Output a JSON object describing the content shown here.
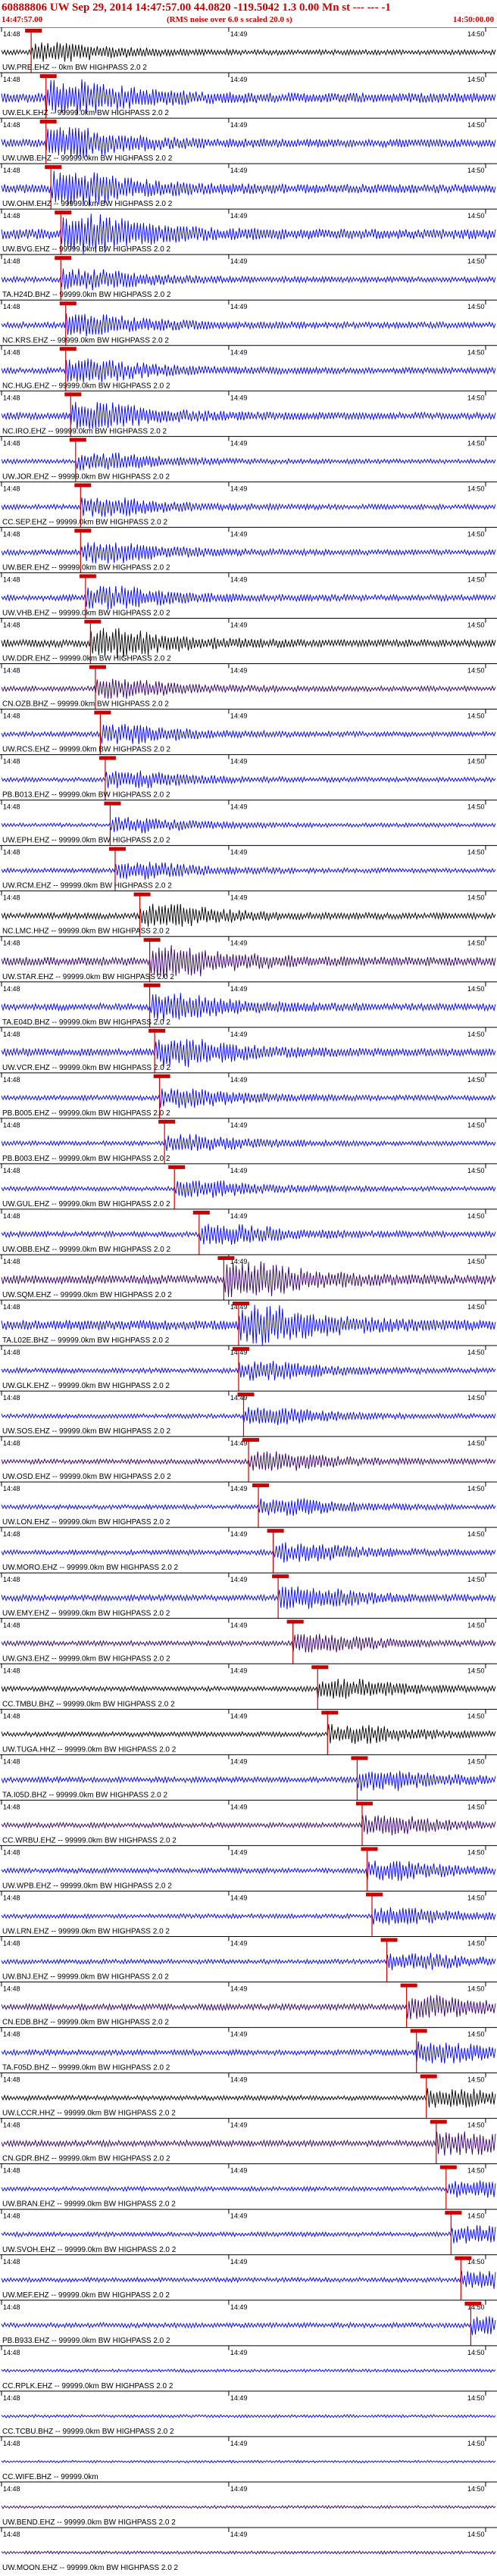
{
  "header": {
    "title": "60888806 UW Sep 29, 2014 14:47:57.00    44.0820 -119.5042   1.3 0.00 Mn st --- --- -1",
    "start_time": "14:47:57.00",
    "rms_note": "(RMS noise over 6.0 s scaled 20.0 s)",
    "end_time": "14:50:00.00"
  },
  "time_ticks": [
    "14:48",
    "14:49",
    "14:50"
  ],
  "colors": {
    "blue": "#0000ff",
    "black": "#000000",
    "purple": "#330066",
    "pick": "#cc0000",
    "tick": "#000000"
  },
  "traces": [
    {
      "label": "UW.PRE.EHZ -- 0km BW HIGHPASS 2.0 2",
      "color": "black",
      "pick": 0.06,
      "amp": 0.5
    },
    {
      "label": "UW.ELK.EHZ -- 99999.0km BW HIGHPASS 2.0 2",
      "color": "blue",
      "pick": 0.09,
      "amp": 0.95
    },
    {
      "label": "UW.UWB.EHZ -- 99999.0km BW HIGHPASS 2.0 2",
      "color": "blue",
      "pick": 0.09,
      "amp": 0.8
    },
    {
      "label": "UW.OHM.EHZ -- 99999.0km BW HIGHPASS 2.0 2",
      "color": "blue",
      "pick": 0.1,
      "amp": 0.9
    },
    {
      "label": "UW.BVG.EHZ -- 99999.0km BW HIGHPASS 2.0 2",
      "color": "blue",
      "pick": 0.12,
      "amp": 1.0
    },
    {
      "label": "TA.H24D.BHZ -- 99999.0km BW HIGHPASS 2.0 2",
      "color": "blue",
      "pick": 0.12,
      "amp": 0.55
    },
    {
      "label": "NC.KRS.EHZ -- 99999.0km BW HIGHPASS 2.0 2",
      "color": "blue",
      "pick": 0.13,
      "amp": 0.6
    },
    {
      "label": "NC.HUG.EHZ -- 99999.0km BW HIGHPASS 2.0 2",
      "color": "blue",
      "pick": 0.13,
      "amp": 0.6
    },
    {
      "label": "NC.IRO.EHZ -- 99999.0km BW HIGHPASS 2.0 2",
      "color": "blue",
      "pick": 0.14,
      "amp": 0.7
    },
    {
      "label": "UW.JOR.EHZ -- 99999.0km BW HIGHPASS 2.0 2",
      "color": "blue",
      "pick": 0.15,
      "amp": 0.45
    },
    {
      "label": "CC.SEP.EHZ -- 99999.0km BW HIGHPASS 2.0 2",
      "color": "blue",
      "pick": 0.16,
      "amp": 0.5
    },
    {
      "label": "UW.BER.EHZ -- 99999.0km BW HIGHPASS 2.0 2",
      "color": "blue",
      "pick": 0.16,
      "amp": 0.55
    },
    {
      "label": "UW.VHB.EHZ -- 99999.0km BW HIGHPASS 2.0 2",
      "color": "blue",
      "pick": 0.17,
      "amp": 0.6
    },
    {
      "label": "UW.DDR.EHZ -- 99999.0km BW HIGHPASS 2.0 2",
      "color": "black",
      "pick": 0.18,
      "amp": 0.75
    },
    {
      "label": "CN.OZB.BHZ -- 99999.0km BW HIGHPASS 2.0 2",
      "color": "purple",
      "pick": 0.19,
      "amp": 0.5
    },
    {
      "label": "UW.RCS.EHZ -- 99999.0km BW HIGHPASS 2.0 2",
      "color": "blue",
      "pick": 0.2,
      "amp": 0.5
    },
    {
      "label": "PB.B013.EHZ -- 99999.0km BW HIGHPASS 2.0 2",
      "color": "blue",
      "pick": 0.21,
      "amp": 0.45
    },
    {
      "label": "UW.EPH.EHZ -- 99999.0km BW HIGHPASS 2.0 2",
      "color": "blue",
      "pick": 0.22,
      "amp": 0.4
    },
    {
      "label": "UW.RCM.EHZ -- 99999.0km BW HIGHPASS 2.0 2",
      "color": "blue",
      "pick": 0.23,
      "amp": 0.45
    },
    {
      "label": "NC.LMC.HHZ -- 99999.0km BW HIGHPASS 2.0 2",
      "color": "black",
      "pick": 0.28,
      "amp": 0.6
    },
    {
      "label": "UW.STAR.EHZ -- 99999.0km BW HIGHPASS 2.0 2",
      "color": "purple",
      "pick": 0.3,
      "amp": 0.85
    },
    {
      "label": "TA.E04D.BHZ -- 99999.0km BW HIGHPASS 2.0 2",
      "color": "blue",
      "pick": 0.3,
      "amp": 0.7
    },
    {
      "label": "UW.VCR.EHZ -- 99999.0km BW HIGHPASS 2.0 2",
      "color": "blue",
      "pick": 0.31,
      "amp": 0.75
    },
    {
      "label": "PB.B005.EHZ -- 99999.0km BW HIGHPASS 2.0 2",
      "color": "blue",
      "pick": 0.32,
      "amp": 0.5
    },
    {
      "label": "PB.B003.EHZ -- 99999.0km BW HIGHPASS 2.0 2",
      "color": "blue",
      "pick": 0.33,
      "amp": 0.45
    },
    {
      "label": "UW.GUL.EHZ -- 99999.0km BW HIGHPASS 2.0 2",
      "color": "blue",
      "pick": 0.35,
      "amp": 0.45
    },
    {
      "label": "UW.OBB.EHZ -- 99999.0km BW HIGHPASS 2.0 2",
      "color": "blue",
      "pick": 0.4,
      "amp": 0.55
    },
    {
      "label": "UW.SQM.EHZ -- 99999.0km BW HIGHPASS 2.0 2",
      "color": "purple",
      "pick": 0.45,
      "amp": 0.9
    },
    {
      "label": "TA.L02E.BHZ -- 99999.0km BW HIGHPASS 2.0 2",
      "color": "blue",
      "pick": 0.48,
      "amp": 1.0
    },
    {
      "label": "UW.GLK.EHZ -- 99999.0km BW HIGHPASS 2.0 2",
      "color": "blue",
      "pick": 0.48,
      "amp": 0.5
    },
    {
      "label": "UW.SOS.EHZ -- 99999.0km BW HIGHPASS 2.0 2",
      "color": "blue",
      "pick": 0.49,
      "amp": 0.45
    },
    {
      "label": "UW.OSD.EHZ -- 99999.0km BW HIGHPASS 2.0 2",
      "color": "purple",
      "pick": 0.5,
      "amp": 0.5
    },
    {
      "label": "UW.LON.EHZ -- 99999.0km BW HIGHPASS 2.0 2",
      "color": "blue",
      "pick": 0.52,
      "amp": 0.45
    },
    {
      "label": "UW.MORO.EHZ -- 99999.0km BW HIGHPASS 2.0 2",
      "color": "blue",
      "pick": 0.55,
      "amp": 0.5
    },
    {
      "label": "UW.EMY.EHZ -- 99999.0km BW HIGHPASS 2.0 2",
      "color": "blue",
      "pick": 0.56,
      "amp": 0.6
    },
    {
      "label": "UW.GN3.EHZ -- 99999.0km BW HIGHPASS 2.0 2",
      "color": "purple",
      "pick": 0.59,
      "amp": 0.5
    },
    {
      "label": "CC.TMBU.BHZ -- 99999.0km BW HIGHPASS 2.0 2",
      "color": "black",
      "pick": 0.64,
      "amp": 0.5
    },
    {
      "label": "UW.TUGA.HHZ -- 99999.0km BW HIGHPASS 2.0 2",
      "color": "black",
      "pick": 0.66,
      "amp": 0.5
    },
    {
      "label": "TA.I05D.BHZ -- 99999.0km BW HIGHPASS 2.0 2",
      "color": "blue",
      "pick": 0.72,
      "amp": 0.55
    },
    {
      "label": "CC.WRBU.EHZ -- 99999.0km BW HIGHPASS 2.0 2",
      "color": "purple",
      "pick": 0.73,
      "amp": 0.5
    },
    {
      "label": "UW.WPB.EHZ -- 99999.0km BW HIGHPASS 2.0 2",
      "color": "blue",
      "pick": 0.74,
      "amp": 0.5
    },
    {
      "label": "UW.LRN.EHZ -- 99999.0km BW HIGHPASS 2.0 2",
      "color": "blue",
      "pick": 0.75,
      "amp": 0.45
    },
    {
      "label": "UW.BNJ.EHZ -- 99999.0km BW HIGHPASS 2.0 2",
      "color": "blue",
      "pick": 0.78,
      "amp": 0.45
    },
    {
      "label": "CN.EDB.BHZ -- 99999.0km BW HIGHPASS 2.0 2",
      "color": "purple",
      "pick": 0.82,
      "amp": 0.6
    },
    {
      "label": "TA.F05D.BHZ -- 99999.0km BW HIGHPASS 2.0 2",
      "color": "blue",
      "pick": 0.84,
      "amp": 0.55
    },
    {
      "label": "UW.LCCR.HHZ -- 99999.0km BW HIGHPASS 2.0 2",
      "color": "black",
      "pick": 0.86,
      "amp": 0.5
    },
    {
      "label": "CN.GDR.BHZ -- 99999.0km BW HIGHPASS 2.0 2",
      "color": "purple",
      "pick": 0.88,
      "amp": 0.6
    },
    {
      "label": "UW.BRAN.EHZ -- 99999.0km BW HIGHPASS 2.0 2",
      "color": "blue",
      "pick": 0.9,
      "amp": 0.45
    },
    {
      "label": "UW.SVOH.EHZ -- 99999.0km BW HIGHPASS 2.0 2",
      "color": "blue",
      "pick": 0.91,
      "amp": 0.45
    },
    {
      "label": "UW.MEF.EHZ -- 99999.0km BW HIGHPASS 2.0 2",
      "color": "blue",
      "pick": 0.93,
      "amp": 0.45
    },
    {
      "label": "PB.B933.EHZ -- 99999.0km BW HIGHPASS 2.0 2",
      "color": "blue",
      "pick": 0.95,
      "amp": 0.5
    },
    {
      "label": "CC.RPLK.EHZ -- 99999.0km BW HIGHPASS 2.0 2",
      "color": "blue",
      "pick": null,
      "amp": 0.3
    },
    {
      "label": "CC.TCBU.BHZ -- 99999.0km BW HIGHPASS 2.0 2",
      "color": "blue",
      "pick": null,
      "amp": 0.3
    },
    {
      "label": "CC.WIFE.BHZ -- 99999.0km",
      "color": "blue",
      "pick": null,
      "amp": 0.25
    },
    {
      "label": "UW.BEND.EHZ -- 99999.0km BW HIGHPASS 2.0 2",
      "color": "purple",
      "pick": null,
      "amp": 0.3
    },
    {
      "label": "UW.MOON.EHZ -- 99999.0km BW HIGHPASS 2.0 2",
      "color": "purple",
      "pick": null,
      "amp": 0.3
    }
  ]
}
